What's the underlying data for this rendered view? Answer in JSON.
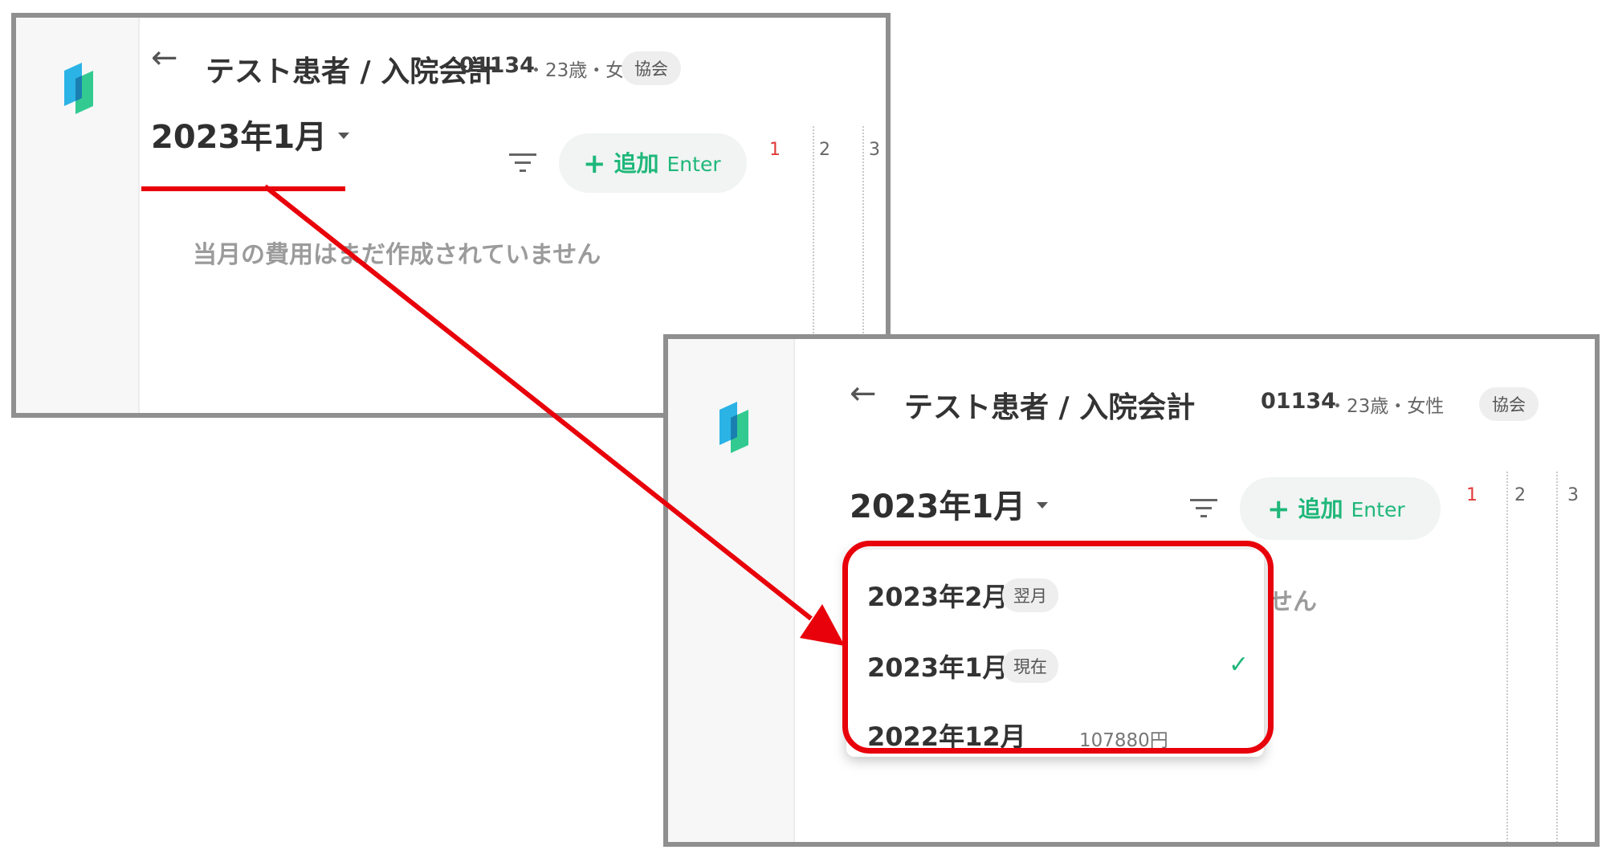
{
  "patient": {
    "title": "テスト患者 / 入院会計",
    "id": "01134",
    "info": "・23歳・女性",
    "org_badge": "協会"
  },
  "toolbar": {
    "current_month": "2023年1月",
    "add_label": "追加",
    "add_shortcut": "Enter"
  },
  "calendar_columns": [
    "1",
    "2",
    "3"
  ],
  "empty_message": "当月の費用はまだ作成されていません",
  "month_dropdown": {
    "items": [
      {
        "label": "2023年2月",
        "tag": "翌月",
        "amount": "",
        "selected": false
      },
      {
        "label": "2023年1月",
        "tag": "現在",
        "amount": "",
        "selected": true
      },
      {
        "label": "2022年12月",
        "tag": "",
        "amount": "107880円",
        "selected": false
      }
    ]
  },
  "partial_empty_message": "せん",
  "colors": {
    "accent": "#1fb77a",
    "annotation": "#e8000a",
    "holiday_column": "#e23a3a"
  },
  "icons": {
    "back": "arrow-left-icon",
    "filter": "filter-lines-icon",
    "add": "plus-icon",
    "selected": "check-icon",
    "logo": "app-logo"
  }
}
